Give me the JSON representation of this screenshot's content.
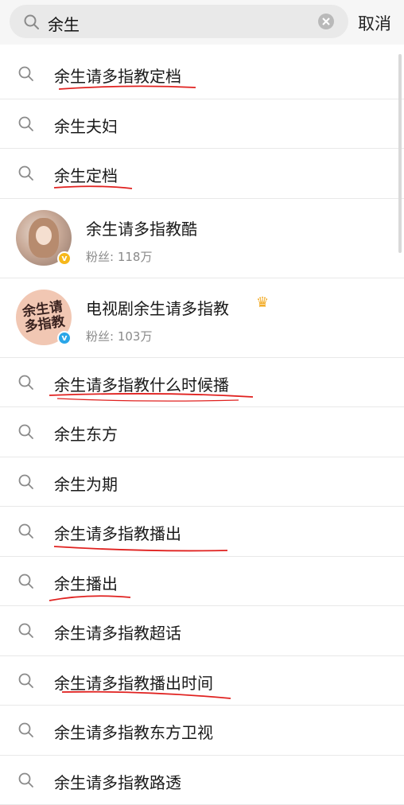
{
  "search": {
    "query": "余生",
    "cancel_label": "取消"
  },
  "suggestions_top": [
    {
      "text": "余生请多指教定档"
    },
    {
      "text": "余生夫妇"
    },
    {
      "text": "余生定档"
    }
  ],
  "users": [
    {
      "name": "余生请多指教酷",
      "fans": "粉丝: 118万",
      "badge": "gold",
      "avatar_text": ""
    },
    {
      "name": "电视剧余生请多指教",
      "fans": "粉丝: 103万",
      "badge": "blue",
      "avatar_text": "余生请多指教"
    }
  ],
  "suggestions_bottom": [
    {
      "text": "余生请多指教什么时候播"
    },
    {
      "text": "余生东方"
    },
    {
      "text": "余生为期"
    },
    {
      "text": "余生请多指教播出"
    },
    {
      "text": "余生播出"
    },
    {
      "text": "余生请多指教超话"
    },
    {
      "text": "余生请多指教播出时间"
    },
    {
      "text": "余生请多指教东方卫视"
    },
    {
      "text": "余生请多指教路透"
    }
  ],
  "colors": {
    "annotation_underline": "#e0211f",
    "verified_gold": "#f6b81c",
    "verified_blue": "#2aa6e8"
  }
}
